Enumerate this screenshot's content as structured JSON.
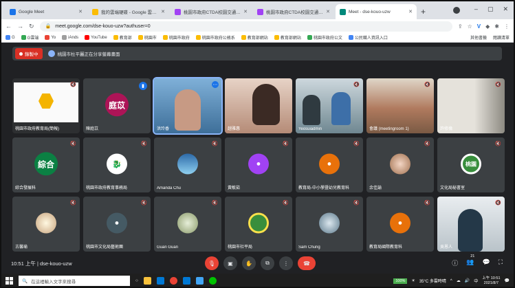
{
  "browser": {
    "tabs": [
      {
        "title": "Google Meet",
        "color": "#1a73e8",
        "active": false
      },
      {
        "title": "我的雲端硬碟 - Google 雲端硬碟",
        "color": "#fbbc04",
        "active": false
      },
      {
        "title": "桃園市政府CTDA校園交通安全",
        "color": "#a142f4",
        "active": false
      },
      {
        "title": "桃園市政府CTDA校園交通安全",
        "color": "#a142f4",
        "active": false
      },
      {
        "title": "Meet - dse-kouo-uzw",
        "color": "#00897b",
        "active": true
      }
    ],
    "new_tab": "+",
    "window_controls": [
      "–",
      "▢",
      "✕"
    ],
    "url": "meet.google.com/dse-kouo-uzw?authuser=0",
    "bookmarks": [
      {
        "label": "G",
        "color": "#4285f4"
      },
      {
        "label": "G雲端",
        "color": "#34a853"
      },
      {
        "label": "Yo",
        "color": "#ea4335"
      },
      {
        "label": "iAnds",
        "color": "#9e9e9e"
      },
      {
        "label": "YouTube",
        "color": "#ff0000"
      },
      {
        "label": "教育部",
        "color": "#fbbc04"
      },
      {
        "label": "桃園市",
        "color": "#fbbc04"
      },
      {
        "label": "桃園市政府",
        "color": "#fbbc04"
      },
      {
        "label": "桃園市政府公務系",
        "color": "#fbbc04"
      },
      {
        "label": "教育部網站",
        "color": "#fbbc04"
      },
      {
        "label": "教育部網站",
        "color": "#fbbc04"
      },
      {
        "label": "桃園市政府公文",
        "color": "#34a853"
      },
      {
        "label": "公民職人資訊入口",
        "color": "#4285f4"
      }
    ],
    "bookmarks_right": [
      "其他書籤",
      "閱讀清單"
    ]
  },
  "meet": {
    "record_label": "錄製中",
    "presenting_text": "桃園市杜平麗正在分享螢幕畫面",
    "meeting_code": "dse-kouo-uzw",
    "time": "10:51 上午",
    "participant_count": "21",
    "tiles": [
      {
        "name": "桃園市政府教育局(簡報)",
        "type": "screen",
        "avatar": "",
        "color": "#ffffff"
      },
      {
        "name": "陳庭苡",
        "type": "avatar",
        "avatar": "庭苡",
        "color": "#ad1457"
      },
      {
        "name": "洪玲香",
        "type": "video",
        "avatar": "",
        "color": "#5b8db8",
        "speaking": true
      },
      {
        "name": "趙雅惠",
        "type": "video",
        "avatar": "",
        "color": "#c9a08c"
      },
      {
        "name": "Yeosuiadmin",
        "type": "video",
        "avatar": "",
        "color": "#8aa1a9"
      },
      {
        "name": "會議 (meetingroom 1)",
        "type": "video",
        "avatar": "",
        "color": "#b5866a"
      },
      {
        "name": "許修倫",
        "type": "video",
        "avatar": "",
        "color": "#a8a39a"
      },
      {
        "name": "綜合發展科",
        "type": "avatar",
        "avatar": "綜合",
        "color": "#0b8043"
      },
      {
        "name": "桃園市政府教育事務局",
        "type": "avatar",
        "avatar": "🐉",
        "color": "#ffffff"
      },
      {
        "name": "Amanda Chu",
        "type": "avatar",
        "avatar": "",
        "color": "#4fa3e0"
      },
      {
        "name": "黃敏茹",
        "type": "avatar",
        "avatar": "👤",
        "color": "#a142f4"
      },
      {
        "name": "教育局-中小學暨幼兒教育科",
        "type": "avatar",
        "avatar": "👤",
        "color": "#e8710a"
      },
      {
        "name": "余佳諭",
        "type": "avatar",
        "avatar": "",
        "color": "#e0b39e"
      },
      {
        "name": "文化局秘書室",
        "type": "avatar",
        "avatar": "桃園",
        "color": "#388e3c"
      },
      {
        "name": "古馨瑜",
        "type": "avatar",
        "avatar": "",
        "color": "#d7ccc8"
      },
      {
        "name": "桃園市文化局藝術團",
        "type": "avatar",
        "avatar": "👤",
        "color": "#455a64"
      },
      {
        "name": "Guan Guan",
        "type": "avatar",
        "avatar": "",
        "color": "#a5b88c"
      },
      {
        "name": "桃園市社平局",
        "type": "avatar",
        "avatar": "",
        "color": "#388e3c"
      },
      {
        "name": "Sam Chung",
        "type": "avatar",
        "avatar": "",
        "color": "#90a4ae"
      },
      {
        "name": "教育局國際教育科",
        "type": "avatar",
        "avatar": "👤",
        "color": "#e8710a"
      },
      {
        "name": "吳恩人",
        "type": "video",
        "avatar": "",
        "color": "#cfd8dc"
      }
    ]
  },
  "taskbar": {
    "search_placeholder": "在這裡輸入文字來搜尋",
    "battery": "100%",
    "weather": "35°C 多雲時晴",
    "ime": "中",
    "clock_time": "上午 10:51",
    "clock_date": "2021/8/7"
  }
}
